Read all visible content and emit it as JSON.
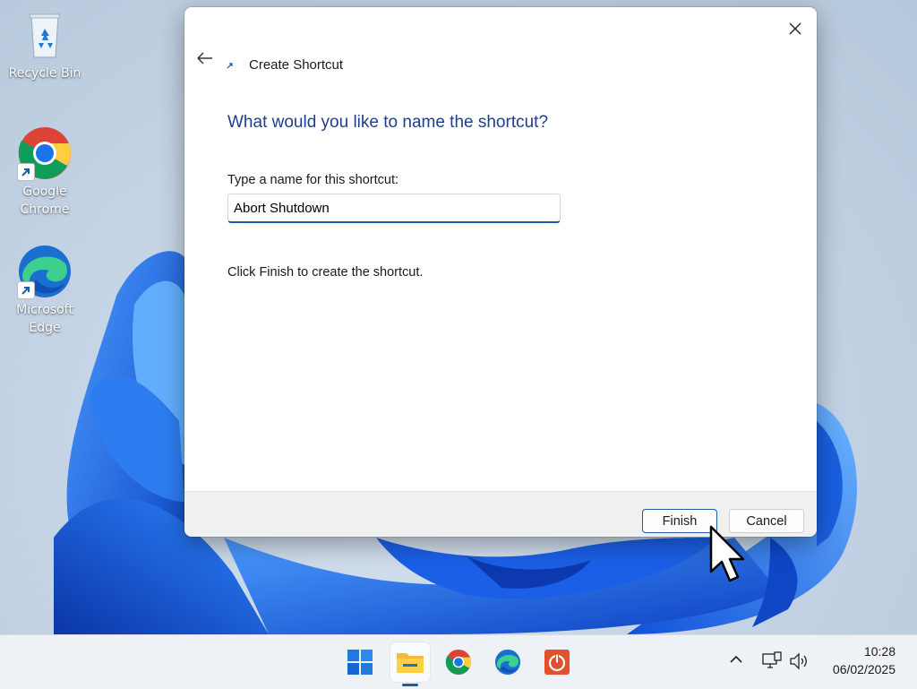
{
  "desktop": {
    "icons": [
      {
        "label": "Recycle Bin",
        "icon": "recycle-bin-icon"
      },
      {
        "label": "Google Chrome",
        "icon": "chrome-icon"
      },
      {
        "label": "Microsoft Edge",
        "icon": "edge-icon"
      }
    ]
  },
  "dialog": {
    "title": "Create Shortcut",
    "heading": "What would you like to name the shortcut?",
    "field_label": "Type a name for this shortcut:",
    "name_value": "Abort Shutdown",
    "hint": "Click Finish to create the shortcut.",
    "finish_label": "Finish",
    "cancel_label": "Cancel"
  },
  "taskbar": {
    "apps": [
      "start-icon",
      "file-explorer-icon",
      "chrome-icon",
      "edge-icon",
      "shutdown-app-icon"
    ],
    "clock_time": "10:28",
    "clock_date": "06/02/2025"
  },
  "colors": {
    "accent": "#1d5aa8",
    "heading": "#1f3e8c",
    "wallpaper_blue": "#1565e0"
  }
}
